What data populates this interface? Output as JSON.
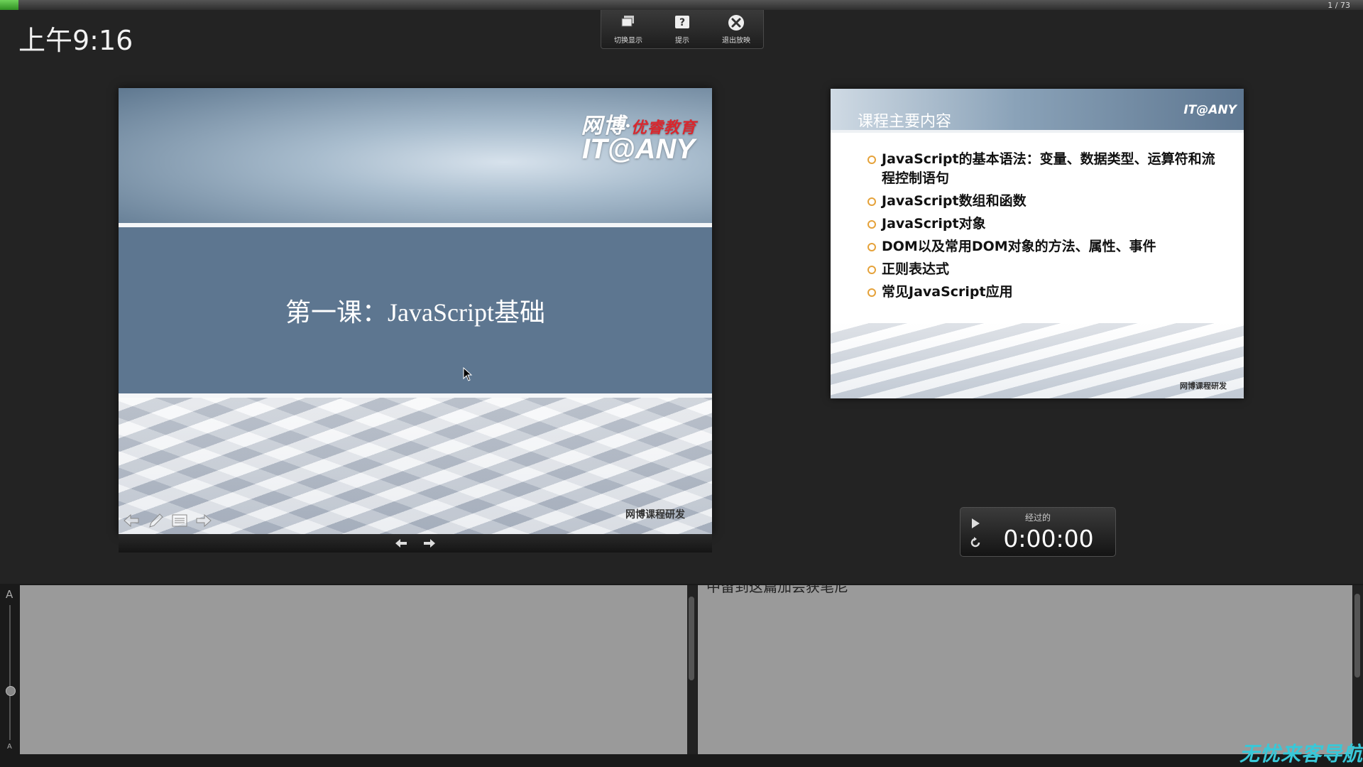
{
  "top_bar": {
    "progress": 0.0137,
    "slide_counter": "1 / 73"
  },
  "clock": "上午9:16",
  "toolbar": {
    "switch_display_label": "切换显示",
    "hint_label": "提示",
    "exit_label": "退出放映"
  },
  "current_slide": {
    "logo_line1_a": "网博·",
    "logo_line1_b": "优睿教育",
    "logo_line2": "IT@ANY",
    "title": "第一课：JavaScript基础",
    "footer": "网博课程研发"
  },
  "next_slide": {
    "title": "课程主要内容",
    "logo": "IT@ANY",
    "items": [
      "JavaScript的基本语法：变量、数据类型、运算符和流程控制语句",
      "JavaScript数组和函数",
      "JavaScript对象",
      "DOM以及常用DOM对象的方法、属性、事件",
      "正则表达式",
      "常见JavaScript应用"
    ],
    "footer": "网博课程研发"
  },
  "timer": {
    "label": "经过的",
    "value": "0:00:00"
  },
  "notes": {
    "font_large_label": "A",
    "font_small_label": "A",
    "right_text": "中留到这篇加会获笔尼"
  },
  "watermark": "无忧来客导航",
  "colors": {
    "progress": "#3fae2e",
    "bullet": "#e5a23a",
    "slide_band": "#5d7690"
  },
  "icons": [
    "switch-display-icon",
    "hint-icon",
    "exit-icon",
    "prev-arrow-icon",
    "pen-icon",
    "menu-icon",
    "next-arrow-icon",
    "play-icon",
    "reset-icon"
  ]
}
